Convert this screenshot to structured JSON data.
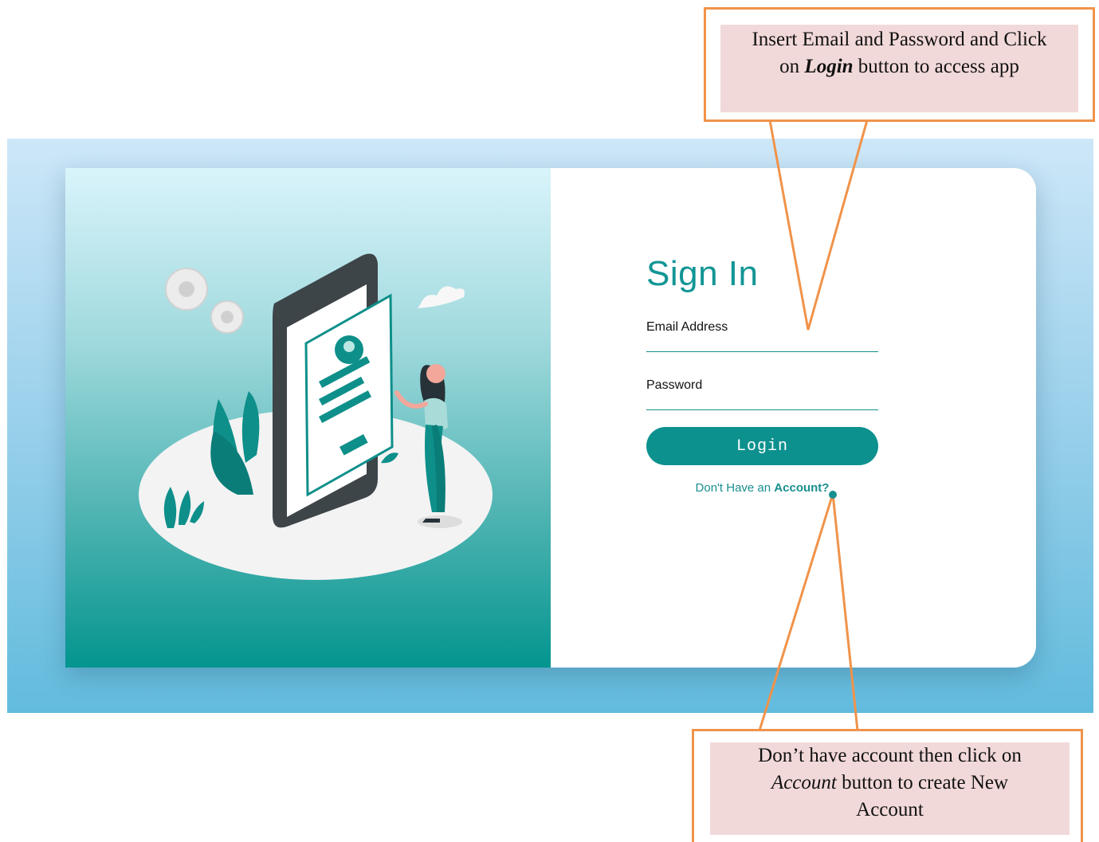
{
  "signin": {
    "title": "Sign In",
    "email_label": "Email Address",
    "email_value": "",
    "password_label": "Password",
    "password_value": "",
    "login_label": "Login",
    "signup_prompt": "Don't Have an ",
    "signup_link": "Account?"
  },
  "callouts": {
    "top": {
      "line1": "Insert Email and Password and Click",
      "line2_pre": "on ",
      "line2_emph": "Login",
      "line2_post": " button to access app"
    },
    "bottom": {
      "line1": "Don’t have account then click on",
      "line2_emph": "Account",
      "line2_post": " button to create New",
      "line3": "Account"
    }
  },
  "colors": {
    "accent": "#0d918f",
    "callout_border": "#f0934a",
    "callout_fill": "#f2d9d9",
    "backdrop_bottom": "#62bbdd"
  },
  "icons": {
    "illustration": "phone-profile-illustration"
  }
}
